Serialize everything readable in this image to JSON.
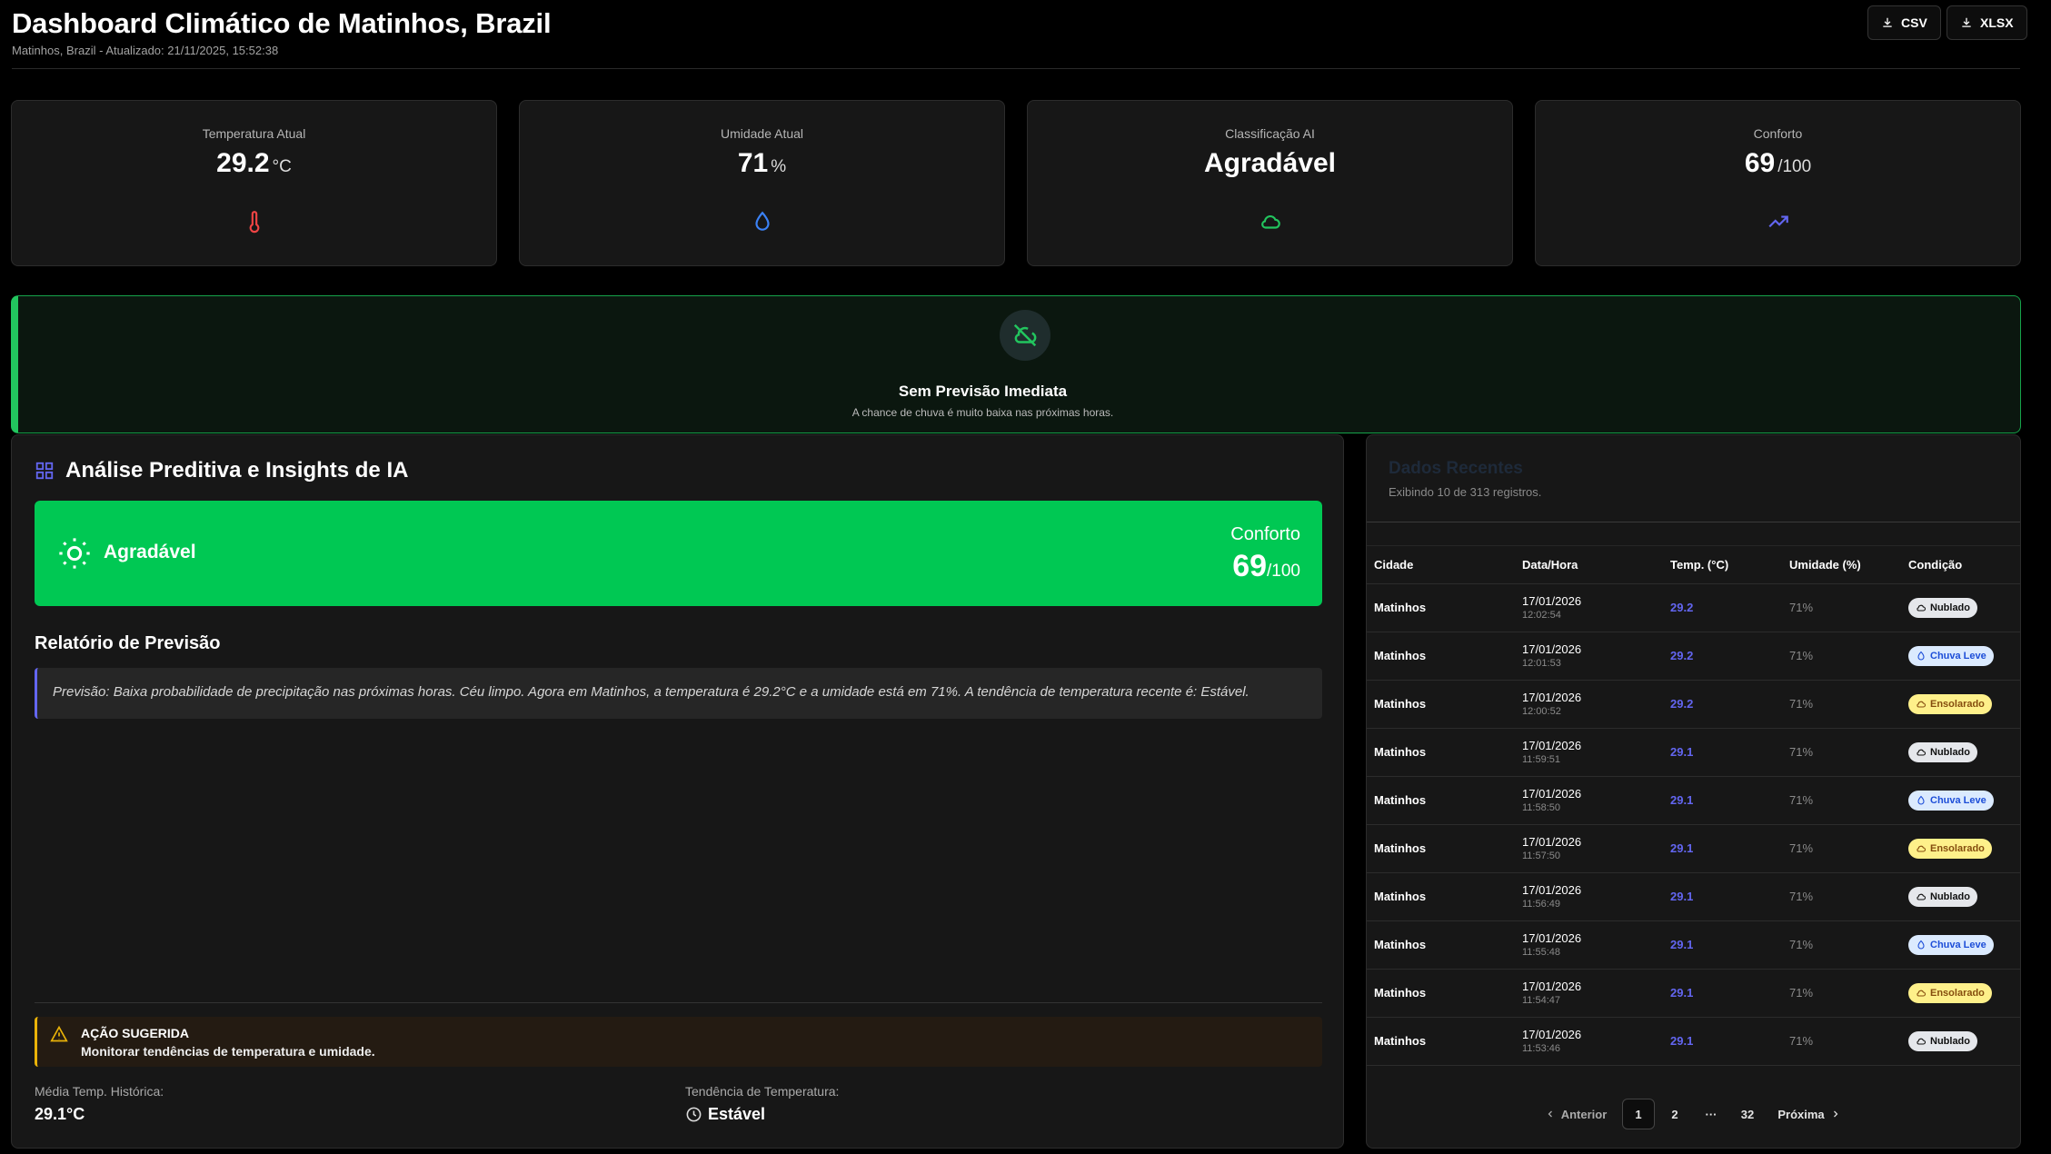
{
  "header": {
    "title": "Dashboard Climático de Matinhos, Brazil",
    "subtitle": "Matinhos, Brazil - Atualizado: 21/11/2025, 15:52:38",
    "csv_label": "CSV",
    "xlsx_label": "XLSX"
  },
  "cards": [
    {
      "label": "Temperatura Atual",
      "value": "29.2",
      "unit": "°C",
      "icon": "thermometer-icon",
      "color": "#ef4444"
    },
    {
      "label": "Umidade Atual",
      "value": "71",
      "unit": "%",
      "icon": "droplet-icon",
      "color": "#3b82f6"
    },
    {
      "label": "Classificação AI",
      "value": "Agradável",
      "unit": "",
      "icon": "cloud-icon",
      "color": "#22c55e"
    },
    {
      "label": "Conforto",
      "value": "69",
      "unit": "/100",
      "icon": "trending-up-icon",
      "color": "#6366f1"
    }
  ],
  "banner": {
    "title": "Sem Previsão Imediata",
    "text": "A chance de chuva é muito baixa nas próximas horas.",
    "icon": "cloud-off-icon",
    "accent": "#22c55e"
  },
  "analysis": {
    "title": "Análise Preditiva e Insights de IA",
    "classification": "Agradável",
    "comfort_label": "Conforto",
    "comfort_value": "69",
    "comfort_unit": "/100",
    "report_title": "Relatório de Previsão",
    "report_text": "Previsão: Baixa probabilidade de precipitação nas próximas horas. Céu limpo. Agora em Matinhos, a temperatura é 29.2°C e a umidade está em 71%. A tendência de temperatura recente é: Estável.",
    "action_title": "AÇÃO SUGERIDA",
    "action_text": "Monitorar tendências de temperatura e umidade.",
    "avg_label": "Média Temp. Histórica:",
    "avg_value": "29.1°C",
    "trend_label": "Tendência de Temperatura:",
    "trend_value": "Estável"
  },
  "records": {
    "title": "Dados Recentes",
    "subtitle": "Exibindo 10 de 313 registros.",
    "columns": [
      "Cidade",
      "Data/Hora",
      "Temp. (°C)",
      "Umidade (%)",
      "Condição"
    ],
    "rows": [
      {
        "city": "Matinhos",
        "date": "17/01/2026",
        "time": "12:02:54",
        "temp": "29.2",
        "hum": "71%",
        "cond": "Nublado",
        "type": "nub"
      },
      {
        "city": "Matinhos",
        "date": "17/01/2026",
        "time": "12:01:53",
        "temp": "29.2",
        "hum": "71%",
        "cond": "Chuva Leve",
        "type": "chu"
      },
      {
        "city": "Matinhos",
        "date": "17/01/2026",
        "time": "12:00:52",
        "temp": "29.2",
        "hum": "71%",
        "cond": "Ensolarado",
        "type": "ens"
      },
      {
        "city": "Matinhos",
        "date": "17/01/2026",
        "time": "11:59:51",
        "temp": "29.1",
        "hum": "71%",
        "cond": "Nublado",
        "type": "nub"
      },
      {
        "city": "Matinhos",
        "date": "17/01/2026",
        "time": "11:58:50",
        "temp": "29.1",
        "hum": "71%",
        "cond": "Chuva Leve",
        "type": "chu"
      },
      {
        "city": "Matinhos",
        "date": "17/01/2026",
        "time": "11:57:50",
        "temp": "29.1",
        "hum": "71%",
        "cond": "Ensolarado",
        "type": "ens"
      },
      {
        "city": "Matinhos",
        "date": "17/01/2026",
        "time": "11:56:49",
        "temp": "29.1",
        "hum": "71%",
        "cond": "Nublado",
        "type": "nub"
      },
      {
        "city": "Matinhos",
        "date": "17/01/2026",
        "time": "11:55:48",
        "temp": "29.1",
        "hum": "71%",
        "cond": "Chuva Leve",
        "type": "chu"
      },
      {
        "city": "Matinhos",
        "date": "17/01/2026",
        "time": "11:54:47",
        "temp": "29.1",
        "hum": "71%",
        "cond": "Ensolarado",
        "type": "ens"
      },
      {
        "city": "Matinhos",
        "date": "17/01/2026",
        "time": "11:53:46",
        "temp": "29.1",
        "hum": "71%",
        "cond": "Nublado",
        "type": "nub"
      }
    ],
    "pager": {
      "prev": "Anterior",
      "p1": "1",
      "p2": "2",
      "ellipsis": "···",
      "last": "32",
      "next": "Próxima"
    }
  }
}
